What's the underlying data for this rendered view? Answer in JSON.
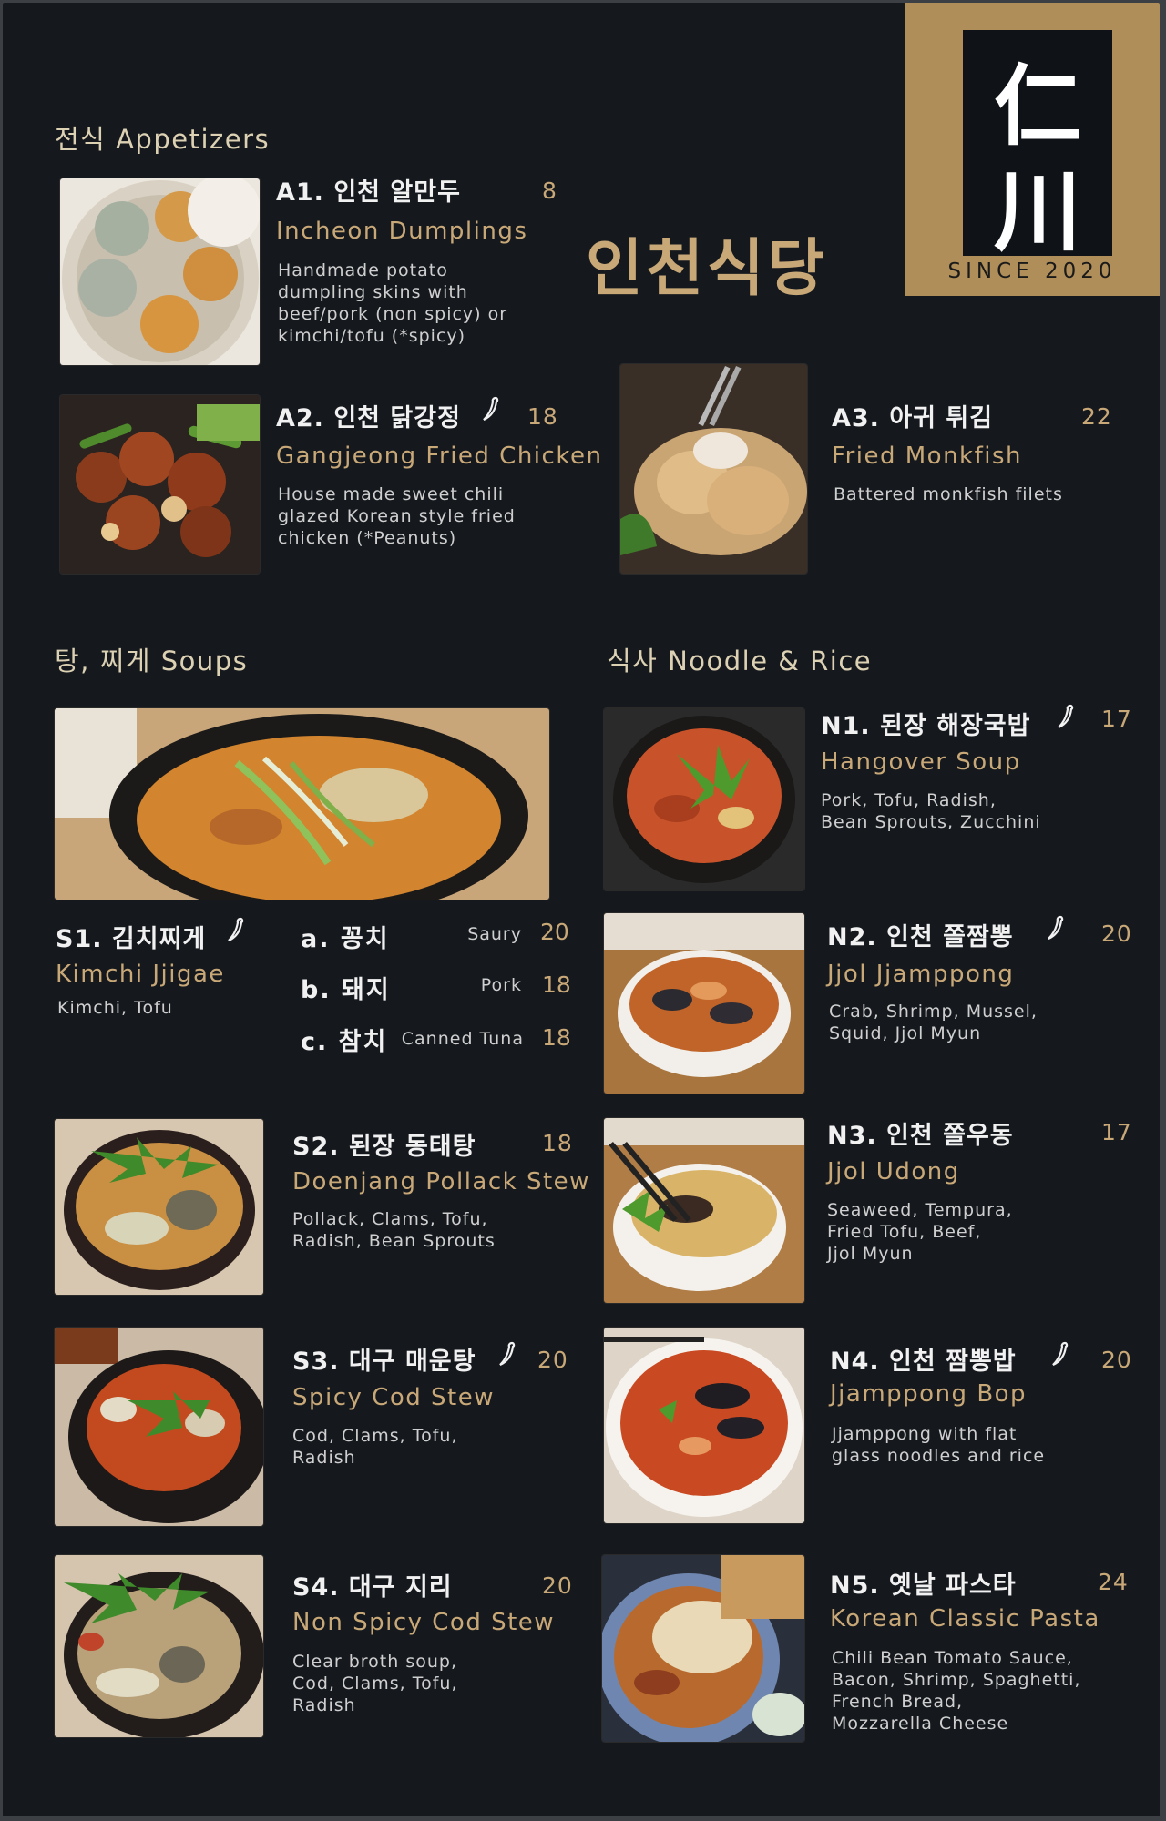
{
  "logo": {
    "char_top": "仁",
    "char_bottom": "川",
    "since": "SINCE 2020"
  },
  "brand_name": "인천식당",
  "sections": {
    "appetizers": "전식 Appetizers",
    "soups": "탕, 찌게 Soups",
    "noodles": "식사 Noodle & Rice"
  },
  "items": {
    "a1": {
      "code": "A1. 인천 알만두",
      "en": "Incheon Dumplings",
      "desc": "Handmade potato\ndumpling skins with\nbeef/pork (non spicy) or\nkimchi/tofu (*spicy)",
      "price": "8"
    },
    "a2": {
      "code": "A2. 인천 닭강정",
      "en": "Gangjeong Fried Chicken",
      "desc": "House made sweet chili\nglazed Korean style fried\nchicken (*Peanuts)",
      "price": "18"
    },
    "a3": {
      "code": "A3. 아귀 튀김",
      "en": "Fried Monkfish",
      "desc": "Battered monkfish filets",
      "price": "22"
    },
    "s1": {
      "code": "S1. 김치찌게",
      "en": "Kimchi Jjigae",
      "desc": "Kimchi, Tofu",
      "options": [
        {
          "name": "a. 꽁치",
          "en": "Saury",
          "price": "20"
        },
        {
          "name": "b. 돼지",
          "en": "Pork",
          "price": "18"
        },
        {
          "name": "c. 참치",
          "en": "Canned Tuna",
          "price": "18"
        }
      ]
    },
    "s2": {
      "code": "S2. 된장 동태탕",
      "en": "Doenjang Pollack Stew",
      "desc": "Pollack, Clams, Tofu,\nRadish, Bean Sprouts",
      "price": "18"
    },
    "s3": {
      "code": "S3. 대구 매운탕",
      "en": "Spicy Cod Stew",
      "desc": "Cod, Clams, Tofu,\nRadish",
      "price": "20"
    },
    "s4": {
      "code": "S4. 대구 지리",
      "en": "Non Spicy Cod Stew",
      "desc": "Clear broth soup,\nCod, Clams, Tofu,\nRadish",
      "price": "20"
    },
    "n1": {
      "code": "N1. 된장 해장국밥",
      "en": "Hangover Soup",
      "desc": "Pork, Tofu, Radish,\nBean Sprouts, Zucchini",
      "price": "17"
    },
    "n2": {
      "code": "N2. 인천 쫄짬뽕",
      "en": "Jjol Jjamppong",
      "desc": "Crab, Shrimp, Mussel,\nSquid, Jjol Myun",
      "price": "20"
    },
    "n3": {
      "code": "N3. 인천 쫄우동",
      "en": "Jjol Udong",
      "desc": "Seaweed, Tempura,\nFried Tofu, Beef,\nJjol Myun",
      "price": "17"
    },
    "n4": {
      "code": "N4. 인천 짬뽕밥",
      "en": "Jjamppong Bop",
      "desc": "Jjamppong with flat\nglass noodles and rice",
      "price": "20"
    },
    "n5": {
      "code": "N5. 옛날 파스타",
      "en": "Korean Classic Pasta",
      "desc": "Chili Bean Tomato Sauce,\nBacon, Shrimp, Spaghetti,\nFrench Bread,\nMozzarella Cheese",
      "price": "24"
    }
  },
  "colors": {
    "background": "#15191e",
    "gold": "#c9a878",
    "logo_panel": "#b08e5a",
    "text": "#f1f1f1"
  },
  "icons": {
    "spicy": "chili-pepper-icon"
  }
}
